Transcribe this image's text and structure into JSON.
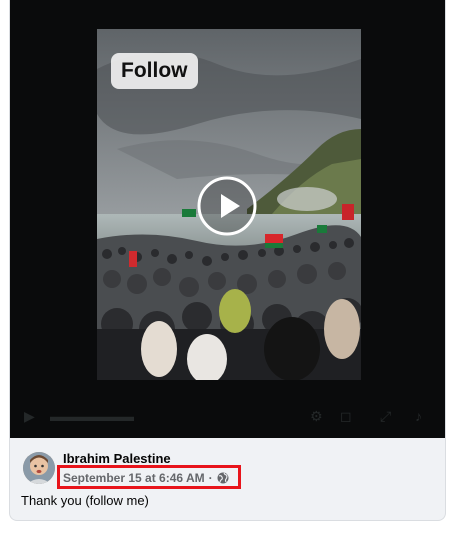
{
  "video": {
    "overlay_label": "Follow",
    "play_icon": "play-icon"
  },
  "post": {
    "author_name": "Ibrahim Palestine",
    "timestamp": "September 15 at 6:46 AM",
    "separator": "·",
    "audience_icon": "globe-icon",
    "caption": "Thank you (follow me)"
  },
  "colors": {
    "highlight": "#e8141b",
    "card_background": "#f0f2f5",
    "video_background": "#0a0b0c",
    "meta_text": "#65676b"
  }
}
